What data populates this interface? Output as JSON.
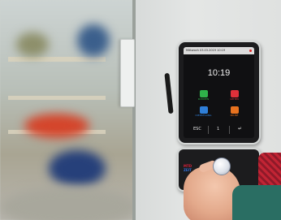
{
  "device": {
    "status_text": "Mittwoch 03.03.2019 10:19",
    "time": "10:19",
    "buttons": [
      {
        "label": "KOMMEN",
        "color": "#2fb24a",
        "icon": "walk-in-icon"
      },
      {
        "label": "GEHEN",
        "color": "#e0303a",
        "icon": "walk-out-icon"
      },
      {
        "label": "DIENSTGANG",
        "color": "#2f7fd8",
        "icon": "errand-icon"
      },
      {
        "label": "PAUSE",
        "color": "#e8731f",
        "icon": "break-icon"
      }
    ],
    "esc_label": "ESC",
    "one_label": "1",
    "enter_label": "↵"
  },
  "reader": {
    "logo_line1": "MTD",
    "logo_line2": "ZEIT"
  }
}
